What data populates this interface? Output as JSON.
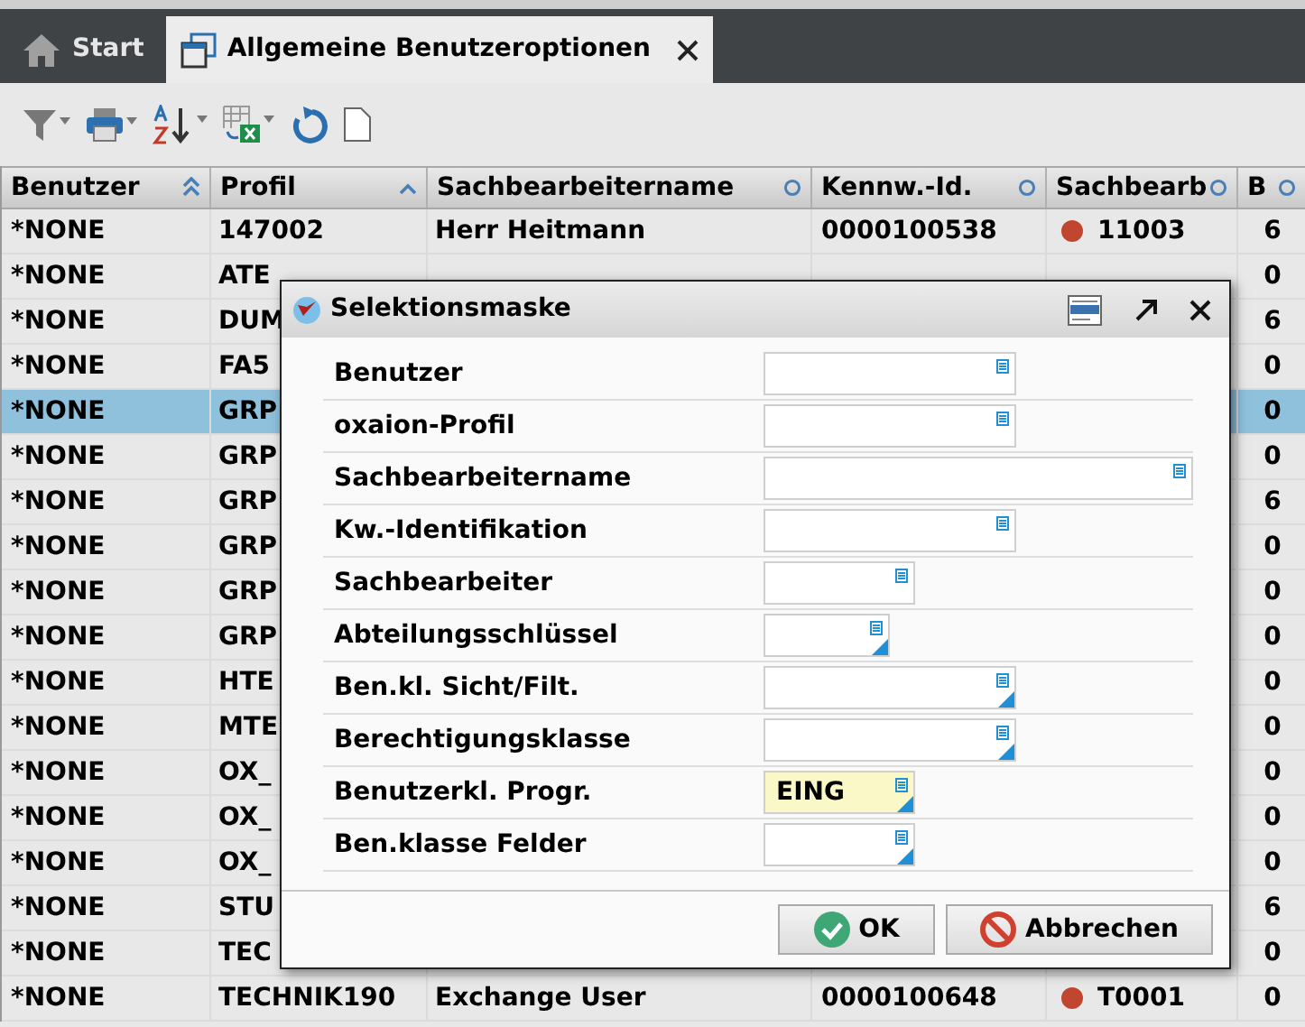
{
  "tabs": [
    {
      "label": "Start",
      "kind": "home",
      "selected": false
    },
    {
      "label": "Allgemeine Benutzeroptionen",
      "kind": "window",
      "selected": true
    }
  ],
  "table": {
    "columns": [
      {
        "label": "Benutzer",
        "kind": "double"
      },
      {
        "label": "Profil",
        "kind": "up"
      },
      {
        "label": "Sachbearbeitername",
        "kind": "circle"
      },
      {
        "label": "Kennw.-Id.",
        "kind": "circle"
      },
      {
        "label": "Sachbearb",
        "kind": "circle"
      },
      {
        "label": "B",
        "kind": "circle"
      }
    ],
    "rows": [
      {
        "benutzer": "*NONE",
        "profil": "147002",
        "name": "Herr Heitmann",
        "kennw": "0000100538",
        "sachbearb": "11003",
        "b": "6",
        "selected": false
      },
      {
        "benutzer": "*NONE",
        "profil": "ATE",
        "b": "0",
        "selected": false
      },
      {
        "benutzer": "*NONE",
        "profil": "DUM",
        "b": "6",
        "selected": false
      },
      {
        "benutzer": "*NONE",
        "profil": "FA5",
        "b": "0",
        "selected": false
      },
      {
        "benutzer": "*NONE",
        "profil": "GRP",
        "b": "0",
        "selected": true
      },
      {
        "benutzer": "*NONE",
        "profil": "GRP",
        "b": "0",
        "selected": false
      },
      {
        "benutzer": "*NONE",
        "profil": "GRP",
        "b": "6",
        "selected": false
      },
      {
        "benutzer": "*NONE",
        "profil": "GRP",
        "b": "0",
        "selected": false
      },
      {
        "benutzer": "*NONE",
        "profil": "GRP",
        "b": "0",
        "selected": false
      },
      {
        "benutzer": "*NONE",
        "profil": "GRP",
        "b": "0",
        "selected": false
      },
      {
        "benutzer": "*NONE",
        "profil": "HTE",
        "b": "0",
        "selected": false
      },
      {
        "benutzer": "*NONE",
        "profil": "MTE",
        "b": "0",
        "selected": false
      },
      {
        "benutzer": "*NONE",
        "profil": "OX_",
        "b": "0",
        "selected": false
      },
      {
        "benutzer": "*NONE",
        "profil": "OX_",
        "b": "0",
        "selected": false
      },
      {
        "benutzer": "*NONE",
        "profil": "OX_",
        "b": "0",
        "selected": false
      },
      {
        "benutzer": "*NONE",
        "profil": "STU",
        "b": "6",
        "selected": false
      },
      {
        "benutzer": "*NONE",
        "profil": "TEC",
        "b": "0",
        "selected": false
      },
      {
        "benutzer": "*NONE",
        "profil": "TECHNIK190",
        "name": "Exchange User",
        "kennw": "0000100648",
        "sachbearb": "T0001",
        "b": "0",
        "selected": false
      }
    ]
  },
  "dialog": {
    "title": "Selektionsmaske",
    "fields": [
      {
        "label": "Benutzer",
        "kind": "medium",
        "corner": false
      },
      {
        "label": "oxaion-Profil",
        "kind": "medium",
        "corner": false
      },
      {
        "label": "Sachbearbeitername",
        "kind": "large",
        "corner": false
      },
      {
        "label": "Kw.-Identifikation",
        "kind": "medium",
        "corner": false
      },
      {
        "label": "Sachbearbeiter",
        "kind": "small",
        "corner": false
      },
      {
        "label": "Abteilungsschlüssel",
        "kind": "tiny",
        "corner": true
      },
      {
        "label": "Ben.kl. Sicht/Filt.",
        "kind": "medium",
        "corner": true
      },
      {
        "label": "Berechtigungsklasse",
        "kind": "medium",
        "corner": true
      },
      {
        "label": "Benutzerkl. Progr.",
        "kind": "small",
        "corner": true,
        "value": "EING"
      },
      {
        "label": "Ben.klasse Felder",
        "kind": "small",
        "corner": true
      }
    ],
    "buttons": [
      {
        "label": "OK",
        "kind": "ok"
      },
      {
        "label": "Abbrechen",
        "kind": "cancel"
      }
    ]
  }
}
